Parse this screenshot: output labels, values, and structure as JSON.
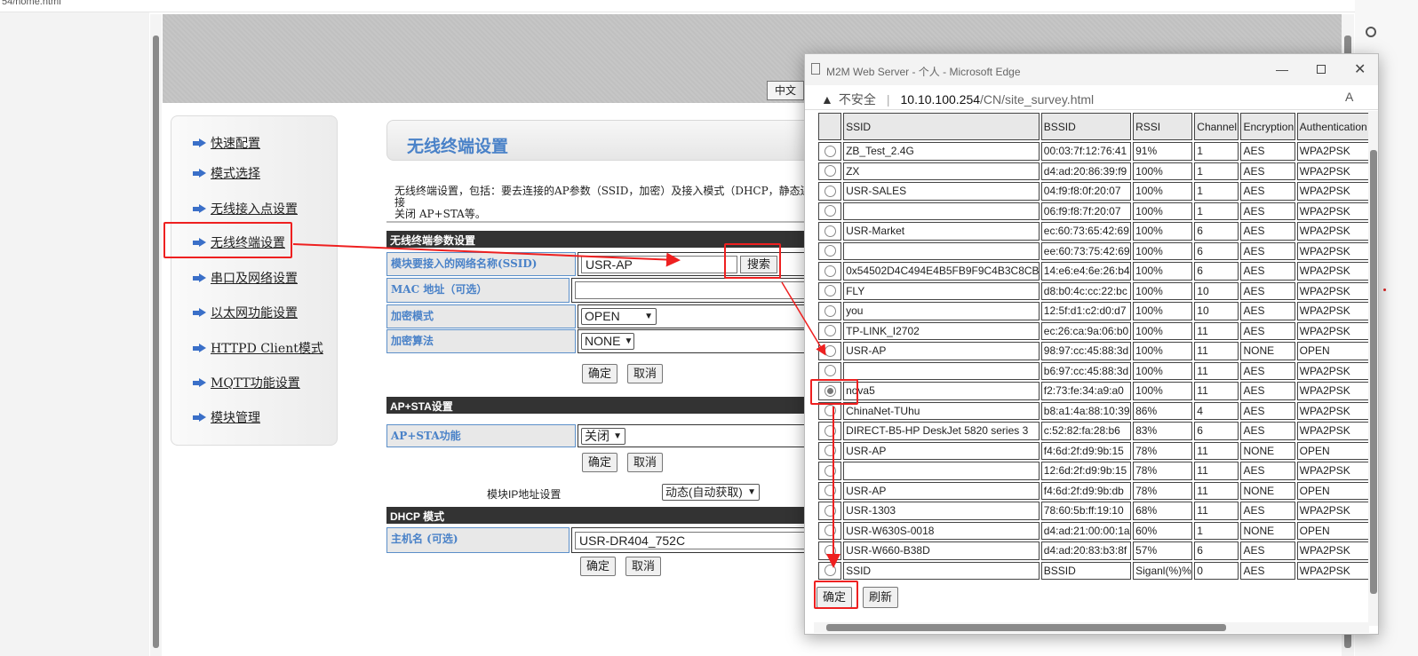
{
  "browser": {
    "url_fragment": "54/home.html"
  },
  "lang_button": "中文",
  "sidebar": {
    "items": [
      {
        "label": "快速配置"
      },
      {
        "label": "模式选择"
      },
      {
        "label": "无线接入点设置"
      },
      {
        "label": "无线终端设置"
      },
      {
        "label": "串口及网络设置"
      },
      {
        "label": "以太网功能设置"
      },
      {
        "label": "HTTPD Client模式"
      },
      {
        "label": "MQTT功能设置"
      },
      {
        "label": "模块管理"
      }
    ]
  },
  "main": {
    "title": "无线终端设置",
    "description_line1": "无线终端设置，包括：要去连接的AP参数（SSID，加密）及接入模式（DHCP，静态连接",
    "description_line2": "关闭 AP+STA等。",
    "section1": {
      "header": "无线终端参数设置",
      "ssid_label": "模块要接入的网络名称(SSID)",
      "ssid_value": "USR-AP",
      "search_button": "搜索",
      "mac_label": "MAC 地址（可选）",
      "mac_value": "",
      "enc_mode_label": "加密模式",
      "enc_mode_value": "OPEN",
      "enc_alg_label": "加密算法",
      "enc_alg_value": "NONE",
      "ok": "确定",
      "cancel": "取消"
    },
    "section2": {
      "header": "AP+STA设置",
      "label": "AP+STA功能",
      "value": "关闭",
      "ok": "确定",
      "cancel": "取消"
    },
    "ip_setting": {
      "label": "模块IP地址设置",
      "value": "动态(自动获取)"
    },
    "section3": {
      "header": "DHCP 模式",
      "label": "主机名 (可选)",
      "value": "USR-DR404_752C",
      "ok": "确定",
      "cancel": "取消"
    }
  },
  "popup": {
    "title": "M2M Web Server - 个人 - Microsoft Edge",
    "insecure": "不安全",
    "url_host": "10.10.100.254",
    "url_path": "/CN/site_survey.html",
    "columns": [
      "SSID",
      "BSSID",
      "RSSI",
      "Channel",
      "Encryption",
      "Authentication"
    ],
    "selected_index": 12,
    "rows": [
      [
        "ZB_Test_2.4G",
        "00:03:7f:12:76:41",
        "91%",
        "1",
        "AES",
        "WPA2PSK"
      ],
      [
        "ZX",
        "d4:ad:20:86:39:f9",
        "100%",
        "1",
        "AES",
        "WPA2PSK"
      ],
      [
        "USR-SALES",
        "04:f9:f8:0f:20:07",
        "100%",
        "1",
        "AES",
        "WPA2PSK"
      ],
      [
        "",
        "06:f9:f8:7f:20:07",
        "100%",
        "1",
        "AES",
        "WPA2PSK"
      ],
      [
        "USR-Market",
        "ec:60:73:65:42:69",
        "100%",
        "6",
        "AES",
        "WPA2PSK"
      ],
      [
        "",
        "ee:60:73:75:42:69",
        "100%",
        "6",
        "AES",
        "WPA2PSK"
      ],
      [
        "0x54502D4C494E4B5FB9F9C4B3C8CB",
        "14:e6:e4:6e:26:b4",
        "100%",
        "6",
        "AES",
        "WPA2PSK"
      ],
      [
        "FLY",
        "d8:b0:4c:cc:22:bc",
        "100%",
        "10",
        "AES",
        "WPA2PSK"
      ],
      [
        "you",
        "12:5f:d1:c2:d0:d7",
        "100%",
        "10",
        "AES",
        "WPA2PSK"
      ],
      [
        "TP-LINK_I2702",
        "ec:26:ca:9a:06:b0",
        "100%",
        "11",
        "AES",
        "WPA2PSK"
      ],
      [
        "USR-AP",
        "98:97:cc:45:88:3d",
        "100%",
        "11",
        "NONE",
        "OPEN"
      ],
      [
        "",
        "b6:97:cc:45:88:3d",
        "100%",
        "11",
        "AES",
        "WPA2PSK"
      ],
      [
        "nova5",
        "f2:73:fe:34:a9:a0",
        "100%",
        "11",
        "AES",
        "WPA2PSK"
      ],
      [
        "ChinaNet-TUhu",
        "b8:a1:4a:88:10:39",
        "86%",
        "4",
        "AES",
        "WPA2PSK"
      ],
      [
        "DIRECT-B5-HP DeskJet 5820 series 3",
        "c:52:82:fa:28:b6",
        "83%",
        "6",
        "AES",
        "WPA2PSK"
      ],
      [
        "USR-AP",
        "f4:6d:2f:d9:9b:15",
        "78%",
        "11",
        "NONE",
        "OPEN"
      ],
      [
        "",
        "12:6d:2f:d9:9b:15",
        "78%",
        "11",
        "AES",
        "WPA2PSK"
      ],
      [
        "USR-AP",
        "f4:6d:2f:d9:9b:db",
        "78%",
        "11",
        "NONE",
        "OPEN"
      ],
      [
        "USR-1303",
        "78:60:5b:ff:19:10",
        "68%",
        "11",
        "AES",
        "WPA2PSK"
      ],
      [
        "USR-W630S-0018",
        "d4:ad:21:00:00:1a",
        "60%",
        "1",
        "NONE",
        "OPEN"
      ],
      [
        "USR-W660-B38D",
        "d4:ad:20:83:b3:8f",
        "57%",
        "6",
        "AES",
        "WPA2PSK"
      ],
      [
        "SSID",
        "BSSID",
        "Siganl(%)%",
        "0",
        "AES",
        "WPA2PSK"
      ]
    ],
    "ok_button": "确定",
    "refresh_button": "刷新"
  },
  "colors": {
    "accent": "#4a82c8",
    "annotation": "#ee2020",
    "section_header": "#333333"
  }
}
